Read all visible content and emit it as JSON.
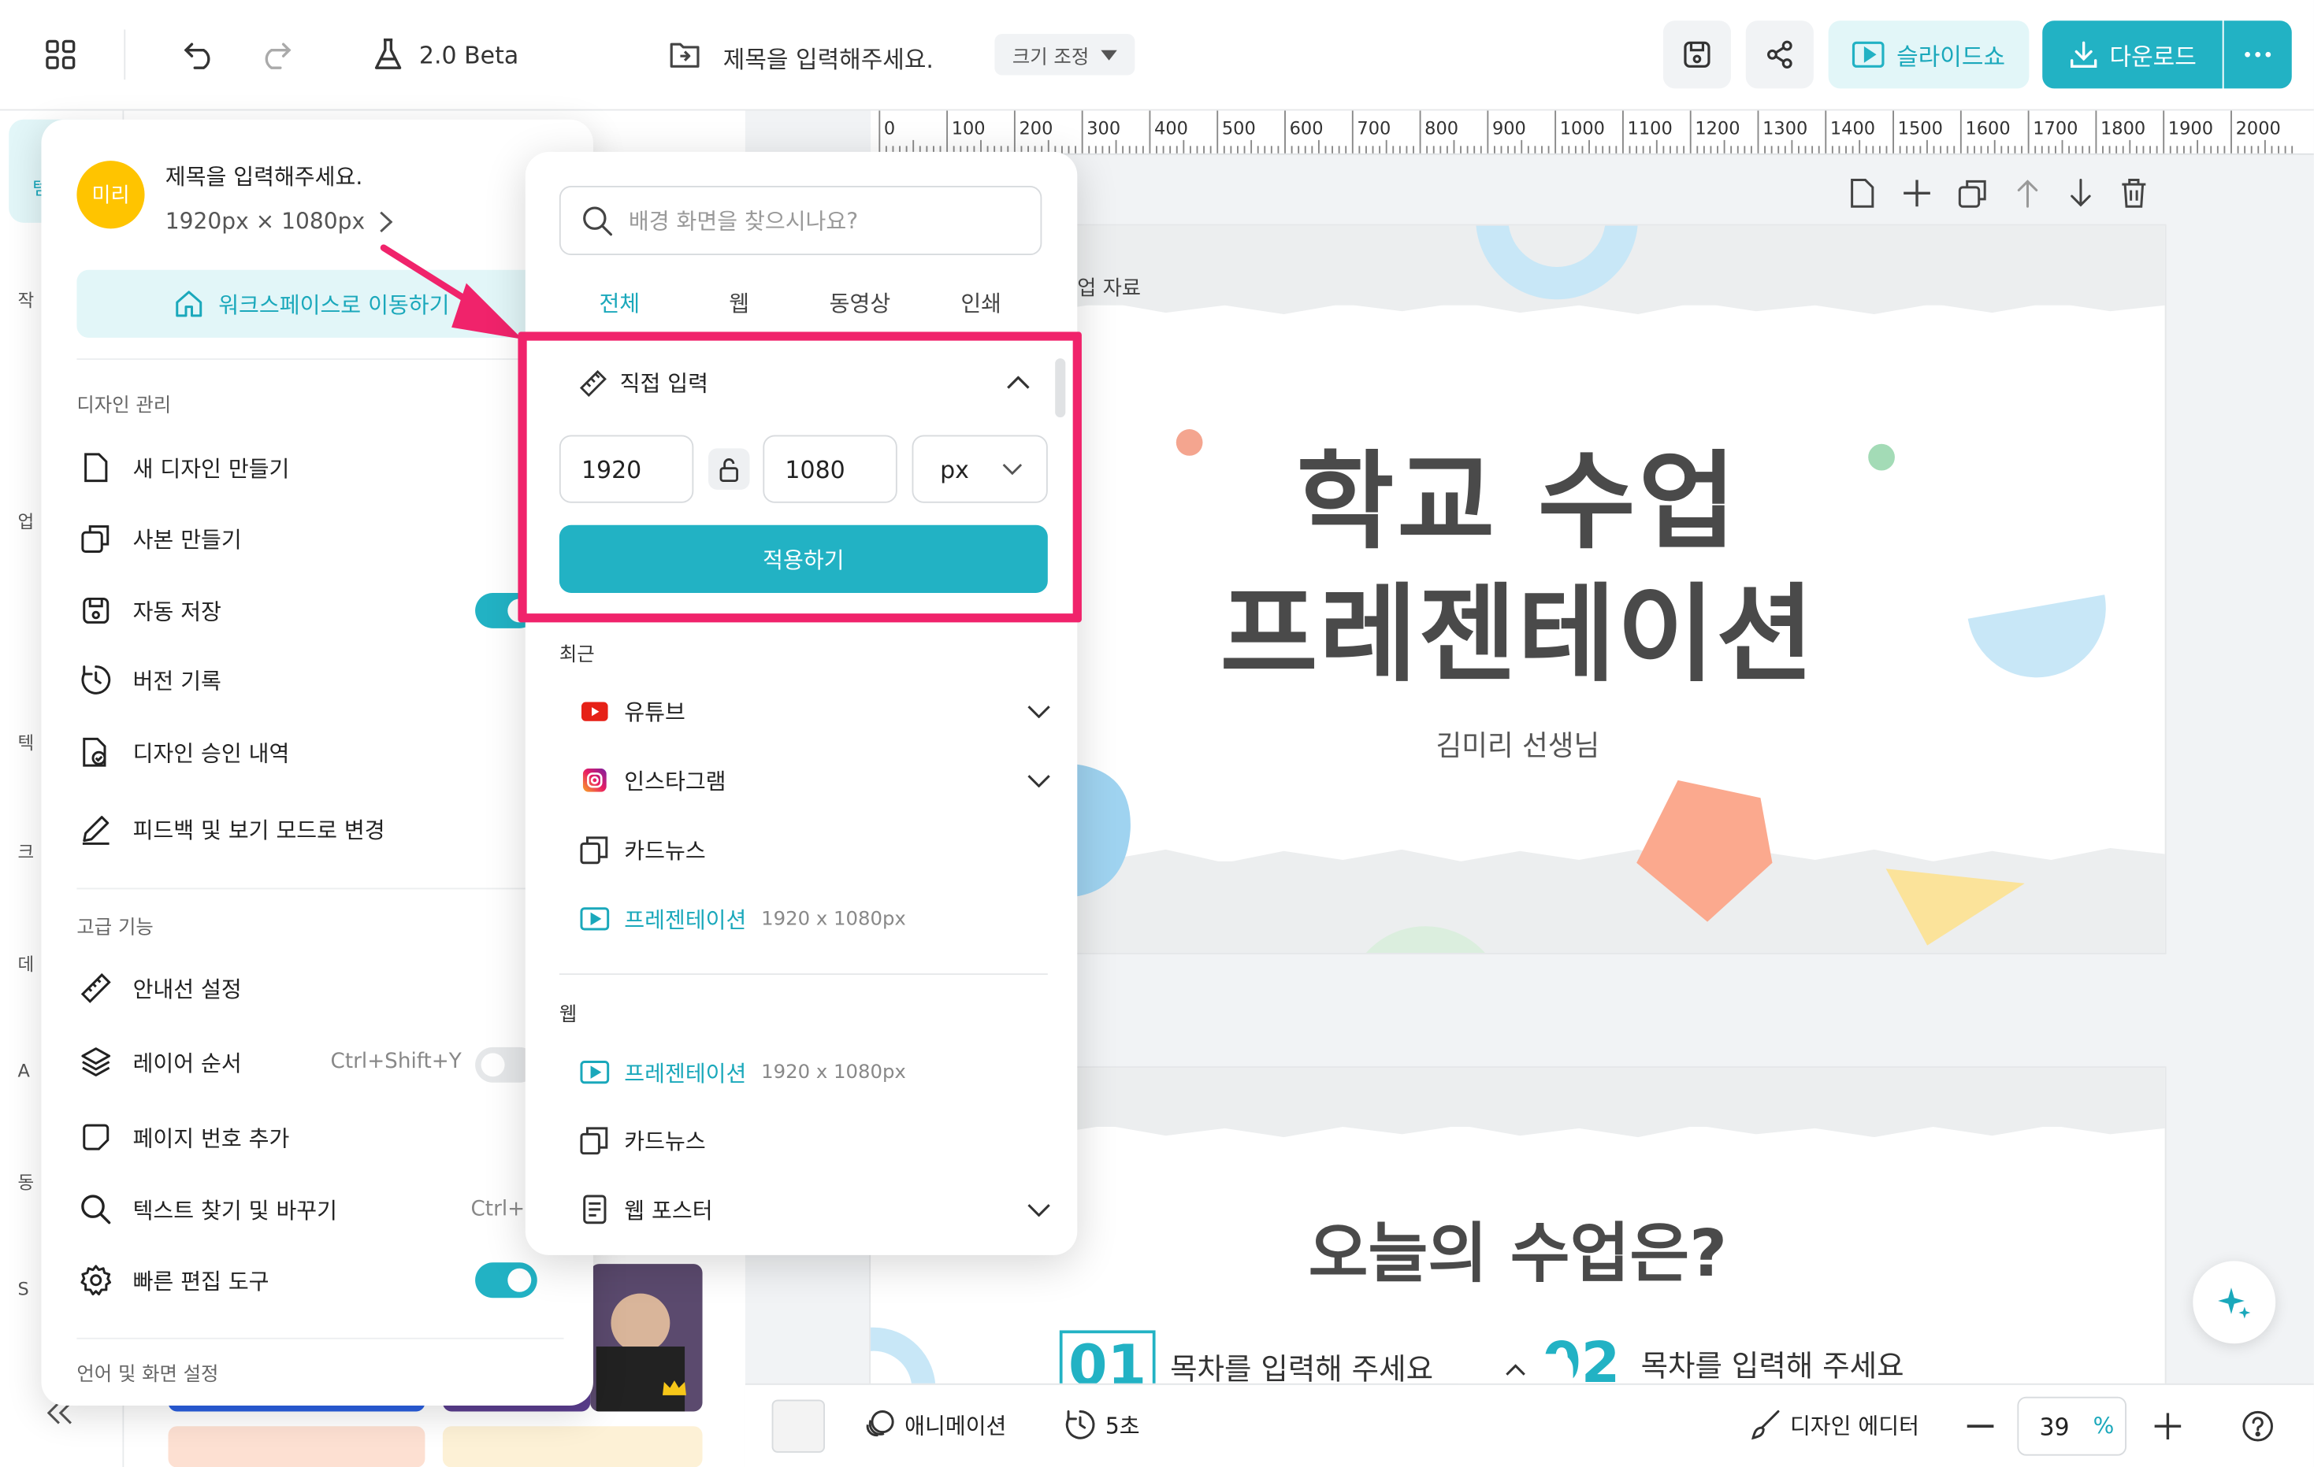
{
  "topbar": {
    "version_label": "2.0 Beta",
    "doc_title": "제목을 입력해주세요.",
    "resize_label": "크기 조정",
    "slideshow_label": "슬라이드쇼",
    "download_label": "다운로드",
    "accent_color": "#22b2c4"
  },
  "ruler": {
    "ticks": [
      "0",
      "100",
      "200",
      "300",
      "400",
      "500",
      "600",
      "700",
      "800",
      "900",
      "1000",
      "1100",
      "1200",
      "1300",
      "1400",
      "1500",
      "1600",
      "1700",
      "1800",
      "1900",
      "2000"
    ]
  },
  "slide1": {
    "corner_label": "업 자료",
    "title_line1": "학교 수업",
    "title_line2": "프레젠테이션",
    "subtitle": "김미리 선생님"
  },
  "slide2": {
    "title": "오늘의 수업은?",
    "item1_num": "01",
    "item1_text": "목차를 입력해 주세요",
    "item2_num": "02",
    "item2_text": "목차를 입력해 주세요"
  },
  "bottombar": {
    "animation_label": "애니메이션",
    "duration_label": "5초",
    "editor_label": "디자인 에디터",
    "zoom_value": "39",
    "zoom_unit": "%"
  },
  "left_rail": {
    "labels": [
      "템",
      "작",
      "업",
      "텍",
      "크",
      "데",
      "A",
      "동",
      "S"
    ]
  },
  "menu": {
    "avatar_text": "미리",
    "title": "제목을 입력해주세요.",
    "size": "1920px × 1080px",
    "workspace_button": "워크스페이스로 이동하기",
    "section1": "디자인 관리",
    "section2": "고급 기능",
    "section3": "언어 및 화면 설정",
    "items": [
      {
        "label": "새 디자인 만들기"
      },
      {
        "label": "사본 만들기"
      },
      {
        "label": "자동 저장"
      },
      {
        "label": "버전 기록"
      },
      {
        "label": "디자인 승인 내역"
      },
      {
        "label": "피드백 및 보기 모드로 변경"
      },
      {
        "label": "안내선 설정"
      },
      {
        "label": "레이어 순서",
        "shortcut": "Ctrl+Shift+Y"
      },
      {
        "label": "페이지 번호 추가"
      },
      {
        "label": "텍스트 찾기 및 바꾸기",
        "shortcut": "Ctrl+"
      },
      {
        "label": "빠른 편집 도구"
      }
    ]
  },
  "popup": {
    "search_placeholder": "배경 화면을 찾으시나요?",
    "tabs": [
      "전체",
      "웹",
      "동영상",
      "인쇄"
    ],
    "custom_header": "직접 입력",
    "width_value": "1920",
    "height_value": "1080",
    "unit_value": "px",
    "apply_label": "적용하기",
    "recent_label": "최근",
    "recent_items": [
      {
        "label": "유튜브"
      },
      {
        "label": "인스타그램"
      },
      {
        "label": "카드뉴스"
      },
      {
        "label": "프레젠테이션",
        "dim": "1920 x 1080px"
      }
    ],
    "web_label": "웹",
    "web_items": [
      {
        "label": "프레젠테이션",
        "dim": "1920 x 1080px"
      },
      {
        "label": "카드뉴스"
      },
      {
        "label": "웹 포스터"
      }
    ],
    "highlight_color": "#f0236b"
  }
}
